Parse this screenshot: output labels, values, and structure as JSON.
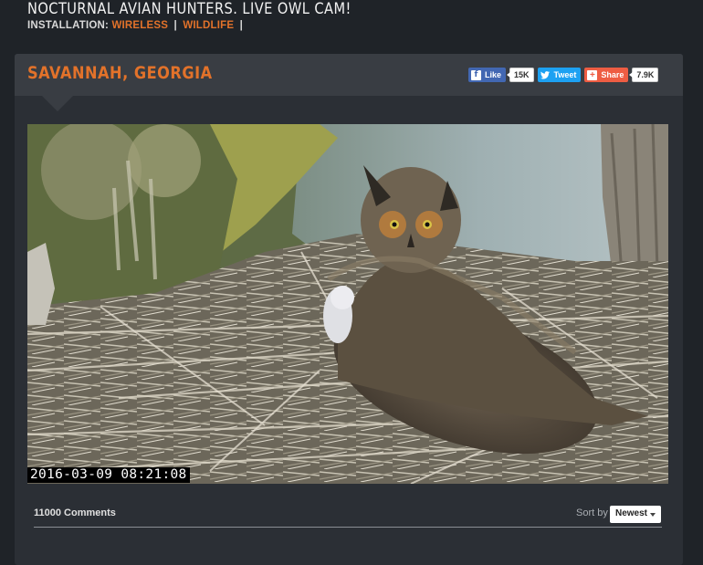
{
  "page": {
    "title": "NOCTURNAL AVIAN HUNTERS. LIVE OWL CAM!",
    "installation_label": "INSTALLATION:",
    "tags": [
      "WIRELESS",
      "WILDLIFE"
    ],
    "separator": "|"
  },
  "panel": {
    "location": "SAVANNAH, GEORGIA",
    "social": {
      "like_label": "Like",
      "like_count": "15K",
      "tweet_label": "Tweet",
      "share_label": "Share",
      "share_count": "7.9K"
    }
  },
  "video": {
    "timestamp": "2016-03-09 08:21:08"
  },
  "comments": {
    "count_label": "11000 Comments",
    "sort_label": "Sort by",
    "sort_value": "Newest"
  },
  "colors": {
    "accent": "#e2722a",
    "background": "#1f2328",
    "panel": "#2b2f35",
    "panel_header": "#393d43",
    "facebook": "#4267b2",
    "twitter": "#1da1f2",
    "share": "#ee5d43"
  }
}
